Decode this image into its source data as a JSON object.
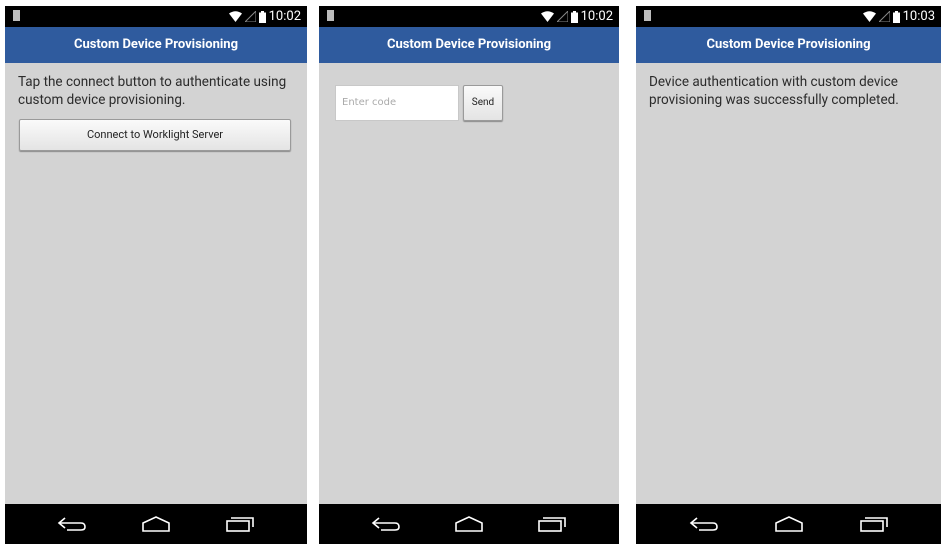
{
  "screens": [
    {
      "status": {
        "time": "10:02"
      },
      "title": "Custom Device Provisioning",
      "message": "Tap the connect button to authenticate using custom device provisioning.",
      "connect_button_label": "Connect to Worklight Server"
    },
    {
      "status": {
        "time": "10:02"
      },
      "title": "Custom Device Provisioning",
      "code_input_placeholder": "Enter code",
      "send_button_label": "Send"
    },
    {
      "status": {
        "time": "10:03"
      },
      "title": "Custom Device Provisioning",
      "message": "Device authentication with custom device provisioning was successfully completed."
    }
  ],
  "icons": {
    "status": [
      "notification-icon",
      "wifi-icon",
      "cellular-signal-icon",
      "battery-icon"
    ],
    "nav": [
      "back-icon",
      "home-icon",
      "recent-apps-icon"
    ]
  },
  "colors": {
    "title_bar": "#2f5b9e",
    "screen_background": "#d3d3d3",
    "system_bars": "#000000"
  }
}
